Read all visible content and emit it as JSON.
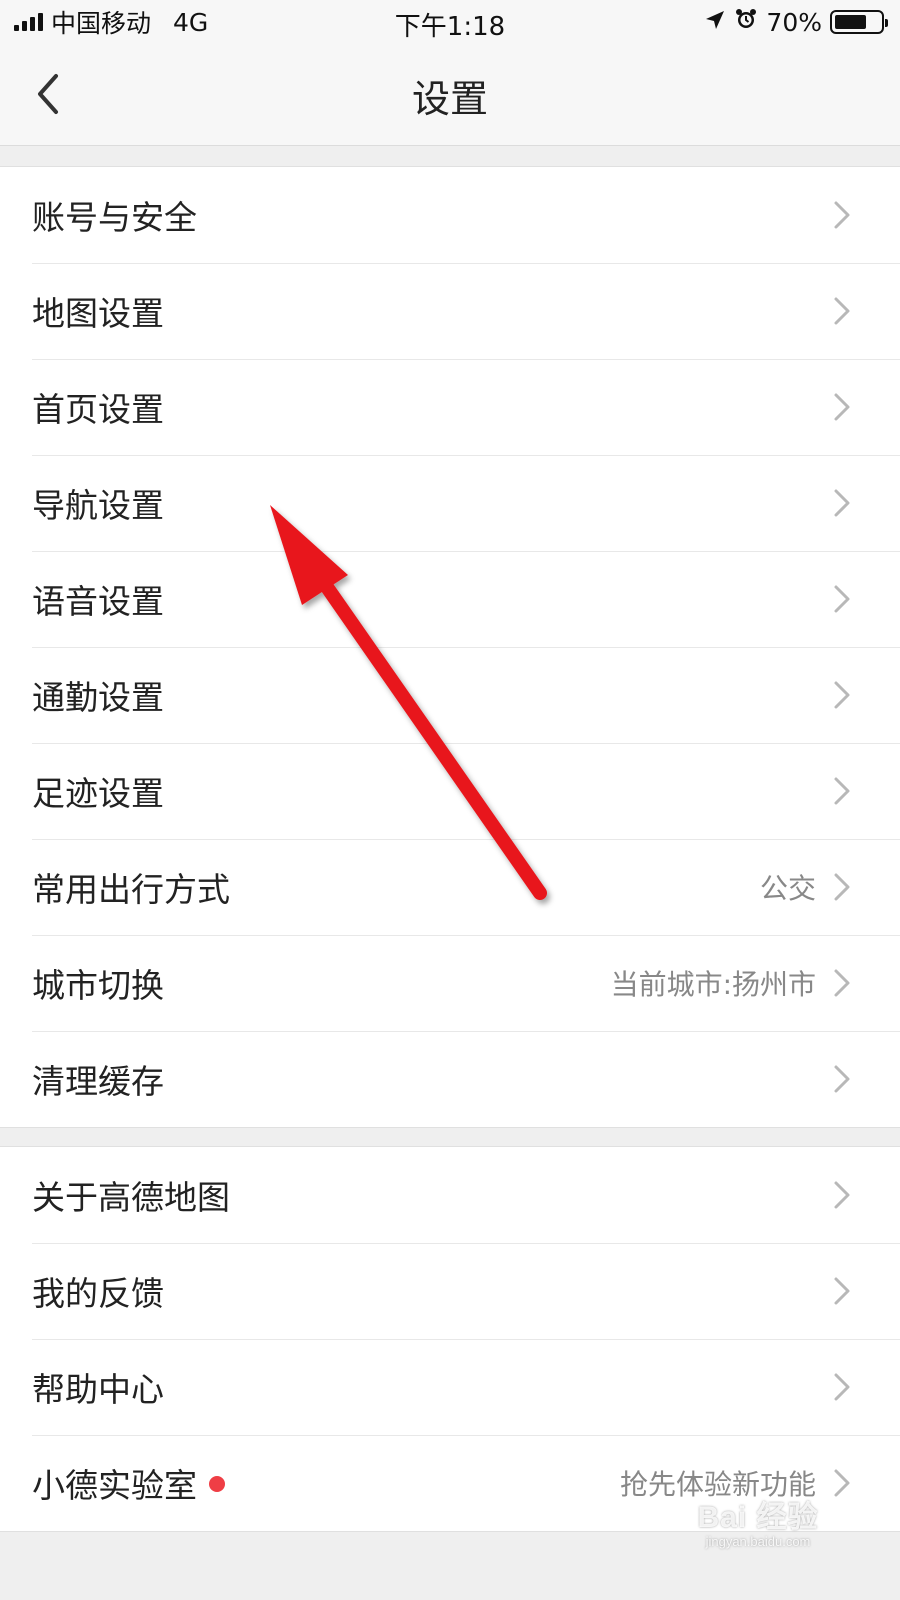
{
  "status_bar": {
    "carrier": "中国移动",
    "network": "4G",
    "time": "下午1:18",
    "battery_text": "70%",
    "battery_level": 0.7
  },
  "nav": {
    "title": "设置",
    "back_icon": "chevron-left-icon"
  },
  "groups": [
    {
      "items": [
        {
          "label": "账号与安全",
          "value": ""
        },
        {
          "label": "地图设置",
          "value": ""
        },
        {
          "label": "首页设置",
          "value": ""
        },
        {
          "label": "导航设置",
          "value": ""
        },
        {
          "label": "语音设置",
          "value": ""
        },
        {
          "label": "通勤设置",
          "value": ""
        },
        {
          "label": "足迹设置",
          "value": ""
        },
        {
          "label": "常用出行方式",
          "value": "公交"
        },
        {
          "label": "城市切换",
          "value": "当前城市:扬州市"
        },
        {
          "label": "清理缓存",
          "value": ""
        }
      ]
    },
    {
      "items": [
        {
          "label": "关于高德地图",
          "value": ""
        },
        {
          "label": "我的反馈",
          "value": ""
        },
        {
          "label": "帮助中心",
          "value": ""
        },
        {
          "label": "小德实验室",
          "value": "抢先体验新功能",
          "badge": "red-dot"
        }
      ]
    }
  ],
  "annotation": {
    "type": "red-arrow",
    "color": "#e8161c"
  },
  "watermark": {
    "main": "Bai 经验",
    "sub": "jingyan.baidu.com"
  },
  "colors": {
    "background": "#efefef",
    "bar": "#f7f7f7",
    "text": "#222222",
    "secondary_text": "#888888",
    "chevron": "#b8b8b8",
    "badge": "#ef3e45"
  }
}
